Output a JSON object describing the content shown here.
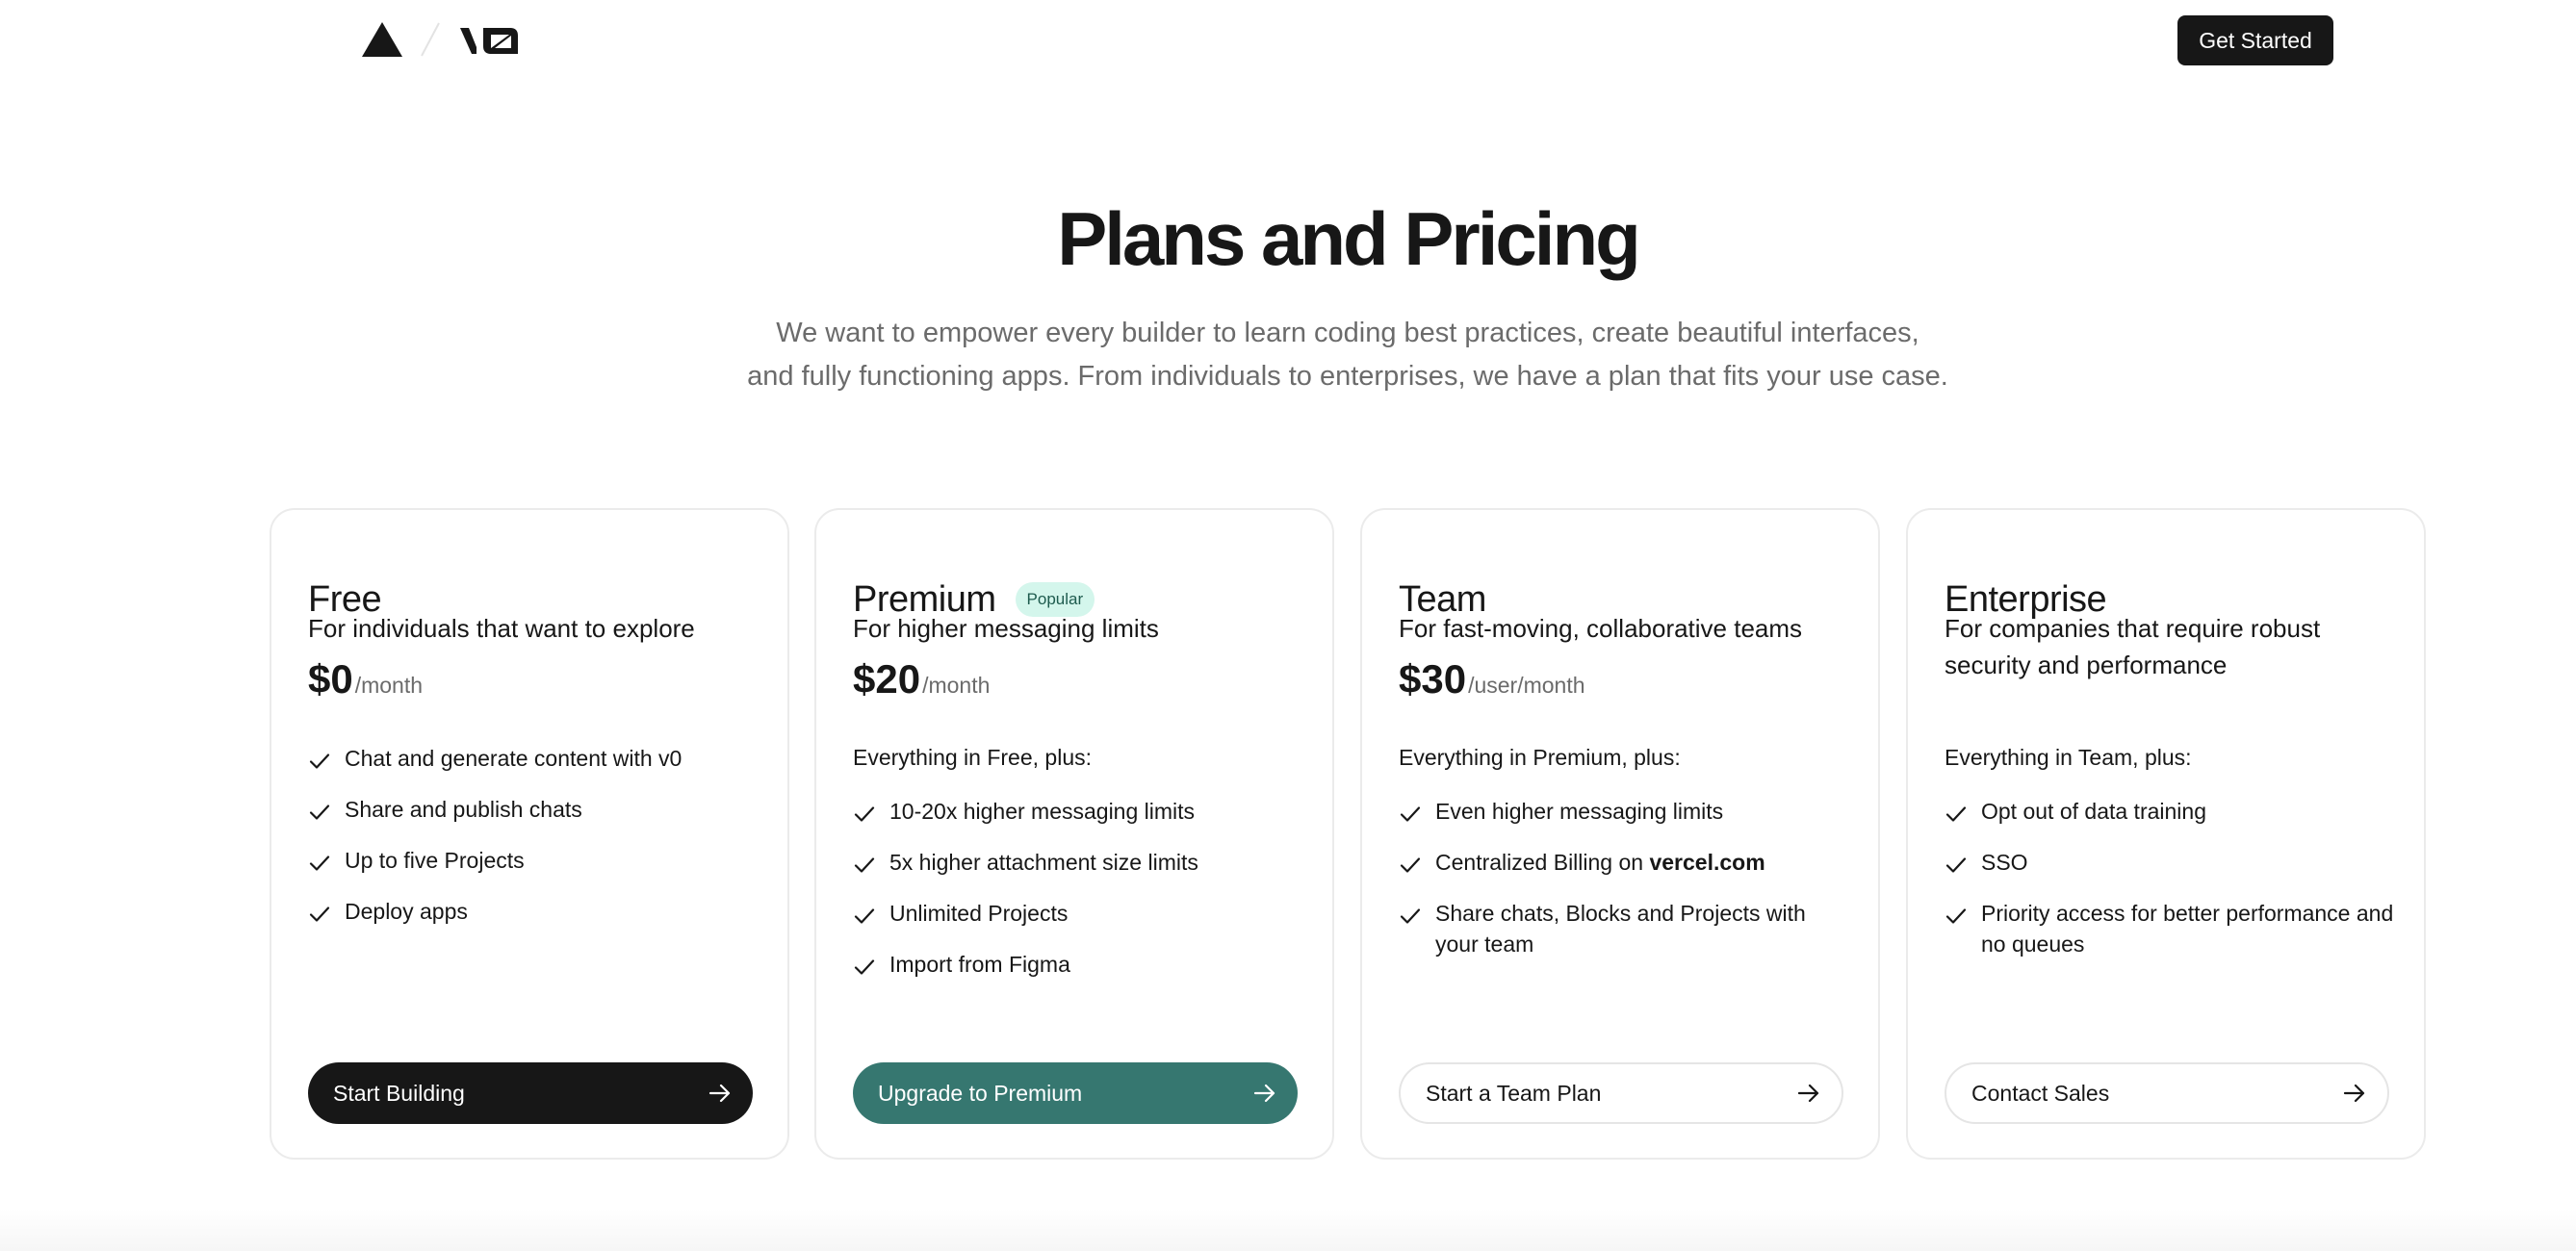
{
  "header": {
    "get_started_label": "Get Started"
  },
  "hero": {
    "title": "Plans and Pricing",
    "subtitle_line1": "We want to empower every builder to learn coding best practices, create beautiful interfaces,",
    "subtitle_line2": "and fully functioning apps. From individuals to enterprises, we have a plan that fits your use case."
  },
  "plans": [
    {
      "name": "Free",
      "description": "For individuals that want to explore",
      "price": "$0",
      "price_unit": "/month",
      "features": [
        "Chat and generate content with v0",
        "Share and publish chats",
        "Up to five Projects",
        "Deploy apps"
      ],
      "cta": "Start Building",
      "cta_style": "dark"
    },
    {
      "name": "Premium",
      "badge": "Popular",
      "description": "For higher messaging limits",
      "price": "$20",
      "price_unit": "/month",
      "features_intro": "Everything in Free, plus:",
      "features": [
        "10-20x higher messaging limits",
        "5x higher attachment size limits",
        "Unlimited Projects",
        "Import from Figma"
      ],
      "cta": "Upgrade to Premium",
      "cta_style": "teal"
    },
    {
      "name": "Team",
      "description": "For fast-moving, collaborative teams",
      "price": "$30",
      "price_unit": "/user/month",
      "features_intro": "Everything in Premium, plus:",
      "features": [
        "Even higher messaging limits",
        "Centralized Billing on",
        "Share chats, Blocks and Projects with your team"
      ],
      "feature_link": "vercel.com",
      "cta": "Start a Team Plan",
      "cta_style": "light"
    },
    {
      "name": "Enterprise",
      "description": "For companies that require robust security and performance",
      "features_intro": "Everything in Team, plus:",
      "features": [
        "Opt out of data training",
        "SSO",
        "Priority access for better performance and no queues"
      ],
      "cta": "Contact Sales",
      "cta_style": "light"
    }
  ],
  "colors": {
    "text_primary": "#171717",
    "text_muted": "#6b6b6b",
    "premium_accent": "#367770",
    "badge_bg": "#d4f6ec",
    "card_border": "#ebebeb"
  },
  "icons": {
    "brand": "vercel-triangle-icon",
    "product": "v0-logo",
    "feature": "check-icon",
    "cta": "arrow-right-icon"
  }
}
